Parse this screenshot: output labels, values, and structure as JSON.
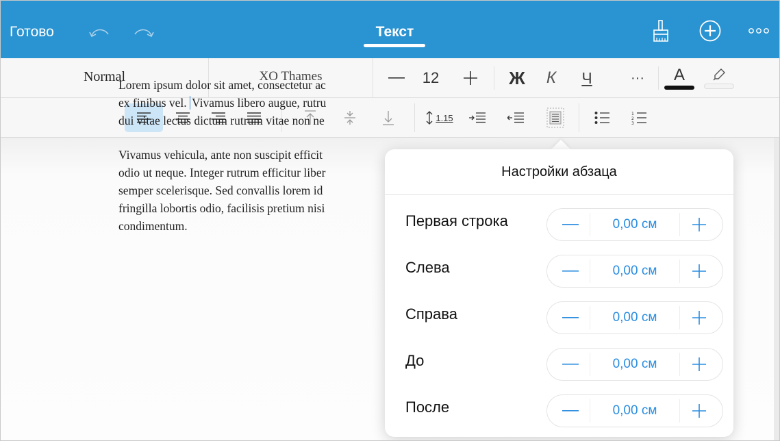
{
  "topbar": {
    "done_label": "Готово",
    "title": "Текст",
    "undo_icon": "undo-icon",
    "redo_icon": "redo-icon",
    "brush_icon": "brush-icon",
    "add_icon": "add-circle-icon",
    "more_icon": "more-icon"
  },
  "format": {
    "style_label": "Normal",
    "font_label": "XO Thames",
    "size_minus": "—",
    "size_value": "12",
    "size_plus": "+",
    "bold": "Ж",
    "italic": "К",
    "underline": "Ч",
    "more": "···",
    "text_color_letter": "A"
  },
  "paragraph_toolbar": {
    "items": [
      "align-left-icon",
      "align-center-icon",
      "align-right-icon",
      "justify-icon",
      "valign-top-icon",
      "valign-middle-icon",
      "valign-bottom-icon",
      "line-spacing-icon",
      "indent-increase-icon",
      "indent-decrease-icon",
      "paragraph-settings-icon",
      "bullet-list-icon",
      "numbered-list-icon"
    ],
    "line_spacing_value": "1.15",
    "active": "align-left-icon"
  },
  "document": {
    "paragraphs": [
      [
        "Lorem ipsum dolor sit amet, consectetur ac",
        "ex finibus vel. ",
        "Vivamus libero augue, rutru",
        "dui vitae lectus dictum rutrum vitae non ne"
      ],
      [
        "Vivamus vehicula, ante non suscipit efficit",
        "odio ut neque. Integer rutrum efficitur liber",
        "semper scelerisque. Sed convallis lorem id",
        "fringilla lobortis odio, facilisis pretium nisi",
        "condimentum."
      ]
    ]
  },
  "popover": {
    "title": "Настройки абзаца",
    "rows": [
      {
        "label": "Первая строка",
        "value": "0,00 см"
      },
      {
        "label": "Слева",
        "value": "0,00 см"
      },
      {
        "label": "Справа",
        "value": "0,00 см"
      },
      {
        "label": "До",
        "value": "0,00 см"
      },
      {
        "label": "После",
        "value": "0,00 см"
      }
    ]
  },
  "colors": {
    "brand": "#2a93d1",
    "accent": "#2a8de0",
    "active_bg": "#cce6f8"
  }
}
